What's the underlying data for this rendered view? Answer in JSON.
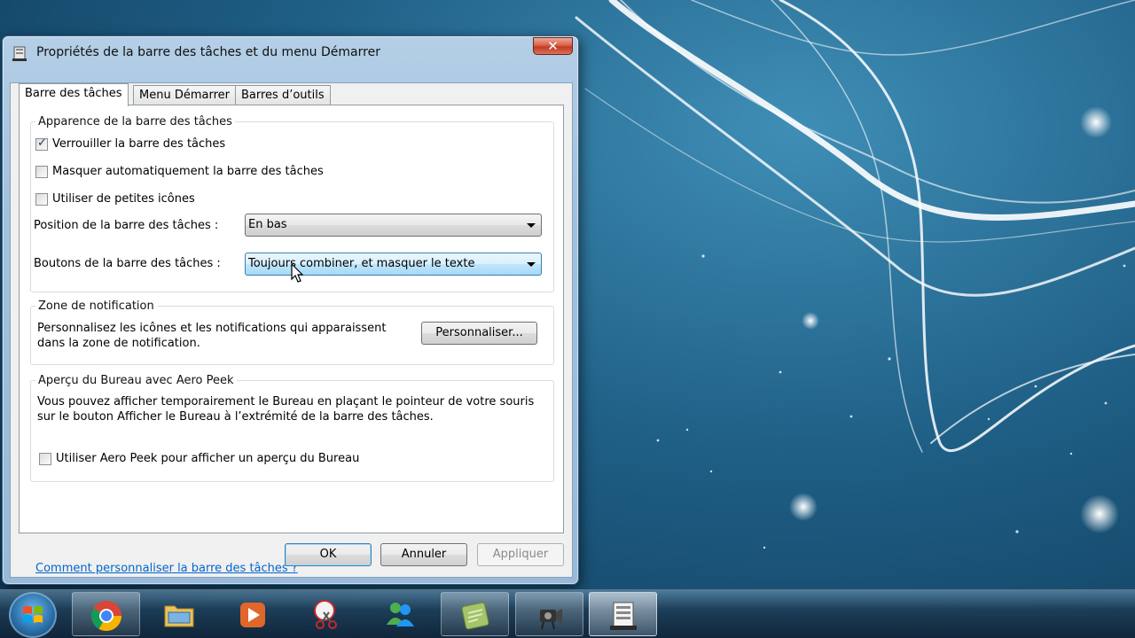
{
  "window": {
    "title": "Propriétés de la barre des tâches et du menu Démarrer",
    "close_label": "✕"
  },
  "tabs": [
    {
      "label": "Barre des tâches",
      "active": true
    },
    {
      "label": "Menu Démarrer",
      "active": false
    },
    {
      "label": "Barres d’outils",
      "active": false
    }
  ],
  "appearance": {
    "title": "Apparence de la barre des tâches",
    "lock_label": "Verrouiller la barre des tâches",
    "lock_checked": true,
    "autohide_label": "Masquer automatiquement la barre des tâches",
    "autohide_checked": false,
    "small_icons_label": "Utiliser de petites icônes",
    "small_icons_checked": false,
    "position_label": "Position de la barre des tâches :",
    "position_value": "En bas",
    "buttons_label": "Boutons de la barre des tâches :",
    "buttons_value": "Toujours combiner, et masquer le texte"
  },
  "notification": {
    "title": "Zone de notification",
    "text_line1": "Personnalisez les icônes et les notifications qui apparaissent",
    "text_line2": "dans la zone de notification.",
    "customize_label": "Personnaliser..."
  },
  "peek": {
    "title": "Aperçu du Bureau avec Aero Peek",
    "text_line1": "Vous pouvez afficher temporairement le Bureau en plaçant le pointeur de votre souris",
    "text_line2": "sur le bouton Afficher le Bureau à l’extrémité de la barre des tâches.",
    "use_peek_label": "Utiliser Aero Peek pour afficher un aperçu du Bureau",
    "use_peek_checked": false
  },
  "help_link": "Comment personnaliser la barre des tâches ?",
  "buttons": {
    "ok": "OK",
    "cancel": "Annuler",
    "apply": "Appliquer"
  },
  "taskbar": {
    "items": [
      {
        "name": "chrome-icon"
      },
      {
        "name": "explorer-folder-icon"
      },
      {
        "name": "media-player-icon"
      },
      {
        "name": "snipping-tool-icon"
      },
      {
        "name": "messenger-icon"
      },
      {
        "name": "notes-app-icon"
      },
      {
        "name": "camera-app-icon"
      },
      {
        "name": "taskbar-properties-icon"
      }
    ]
  }
}
